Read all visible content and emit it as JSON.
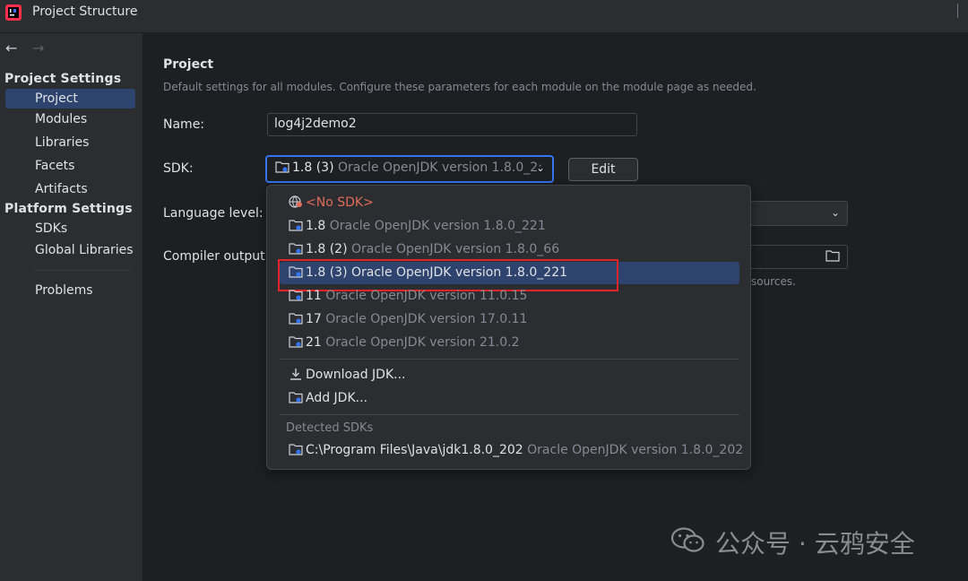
{
  "window": {
    "title": "Project Structure"
  },
  "sidebar": {
    "sections": [
      {
        "label": "Project Settings"
      },
      {
        "label": "Platform Settings"
      }
    ],
    "items": [
      {
        "label": "Project"
      },
      {
        "label": "Modules"
      },
      {
        "label": "Libraries"
      },
      {
        "label": "Facets"
      },
      {
        "label": "Artifacts"
      },
      {
        "label": "SDKs"
      },
      {
        "label": "Global Libraries"
      },
      {
        "label": "Problems"
      }
    ]
  },
  "main": {
    "heading": "Project",
    "description": "Default settings for all modules. Configure these parameters for each module on the module page as needed.",
    "name_label": "Name:",
    "name_value": "log4j2demo2",
    "sdk_label": "SDK:",
    "sdk_selected_version": "1.8 (3)",
    "sdk_selected_desc": "Oracle OpenJDK version 1.8.0_2:",
    "edit_label": "Edit",
    "language_level_label": "Language level:",
    "compiler_output_label": "Compiler output:",
    "sources_fragment": "sources."
  },
  "sdk_popup": {
    "no_sdk": "<No SDK>",
    "items": [
      {
        "version": "1.8",
        "desc": "Oracle OpenJDK version 1.8.0_221"
      },
      {
        "version": "1.8 (2)",
        "desc": "Oracle OpenJDK version 1.8.0_66"
      },
      {
        "version": "1.8 (3)",
        "desc": "Oracle OpenJDK version 1.8.0_221"
      },
      {
        "version": "11",
        "desc": "Oracle OpenJDK version 11.0.15"
      },
      {
        "version": "17",
        "desc": "Oracle OpenJDK version 17.0.11"
      },
      {
        "version": "21",
        "desc": "Oracle OpenJDK version 21.0.2"
      }
    ],
    "download_jdk": "Download JDK...",
    "add_jdk": "Add JDK...",
    "detected_header": "Detected SDKs",
    "detected_items": [
      {
        "path": "C:\\Program Files\\Java\\jdk1.8.0_202",
        "desc": "Oracle OpenJDK version 1.8.0_202"
      }
    ]
  },
  "watermark": {
    "text": "公众号 · 云鸦安全"
  },
  "colors": {
    "accent": "#3574f0",
    "selection": "#2e436e",
    "highlight_box": "#e0242a"
  }
}
